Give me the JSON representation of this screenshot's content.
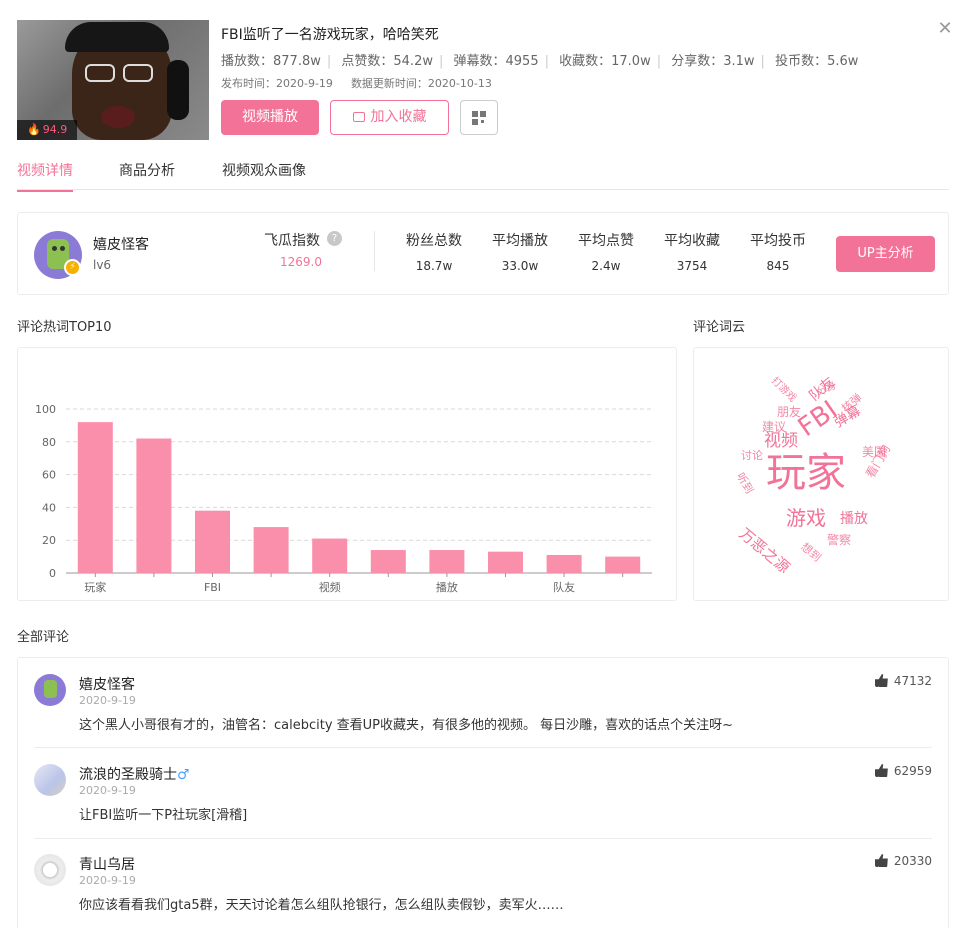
{
  "video": {
    "title": "FBI监听了一名游戏玩家，哈哈笑死",
    "heat": "94.9",
    "stats": [
      {
        "label": "播放数",
        "value": "877.8w"
      },
      {
        "label": "点赞数",
        "value": "54.2w"
      },
      {
        "label": "弹幕数",
        "value": "4955"
      },
      {
        "label": "收藏数",
        "value": "17.0w"
      },
      {
        "label": "分享数",
        "value": "3.1w"
      },
      {
        "label": "投币数",
        "value": "5.6w"
      }
    ],
    "stats_text": {
      "s0": "播放数：877.8w",
      "s1": "点赞数：54.2w",
      "s2": "弹幕数：4955",
      "s3": "收藏数：17.0w",
      "s4": "分享数：3.1w",
      "s5": "投币数：5.6w"
    },
    "publish_time": "发布时间：2020-9-19",
    "update_time": "数据更新时间：2020-10-13",
    "play_button": "视频播放",
    "fav_button": "加入收藏"
  },
  "tabs": [
    "视频详情",
    "商品分析",
    "视频观众画像"
  ],
  "up": {
    "name": "嬉皮怪客",
    "level": "lv6",
    "feigua_label": "飞瓜指数",
    "feigua_value": "1269.0",
    "metrics": [
      {
        "label": "粉丝总数",
        "value": "18.7w"
      },
      {
        "label": "平均播放",
        "value": "33.0w"
      },
      {
        "label": "平均点赞",
        "value": "2.4w"
      },
      {
        "label": "平均收藏",
        "value": "3754"
      },
      {
        "label": "平均投币",
        "value": "845"
      }
    ],
    "analysis_button": "UP主分析"
  },
  "sections": {
    "hot_words": "评论热词TOP10",
    "word_cloud": "评论词云",
    "all_comments": "全部评论"
  },
  "chart_data": {
    "type": "bar",
    "title": "评论热词TOP10",
    "categories": [
      "玩家",
      "",
      "FBI",
      "",
      "视频",
      "",
      "播放",
      "",
      "队友",
      ""
    ],
    "values": [
      92,
      82,
      38,
      28,
      21,
      14,
      14,
      13,
      11,
      10
    ],
    "ylim": [
      0,
      100
    ],
    "yticks": [
      0,
      20,
      40,
      60,
      80,
      100
    ],
    "grid": true,
    "color": "#f98fab"
  },
  "word_cloud": [
    {
      "word": "玩家",
      "size": 40
    },
    {
      "word": "FBI",
      "size": 26
    },
    {
      "word": "游戏",
      "size": 20
    },
    {
      "word": "视频",
      "size": 17
    },
    {
      "word": "队友",
      "size": 14
    },
    {
      "word": "弹幕",
      "size": 14
    },
    {
      "word": "万恶之源",
      "size": 15
    },
    {
      "word": "播放",
      "size": 14
    },
    {
      "word": "美国",
      "size": 12
    },
    {
      "word": "看门狗",
      "size": 12
    },
    {
      "word": "建议",
      "size": 12
    },
    {
      "word": "朋友",
      "size": 12
    },
    {
      "word": "警察",
      "size": 12
    },
    {
      "word": "听到",
      "size": 11
    },
    {
      "word": "想到",
      "size": 11
    },
    {
      "word": "讨论",
      "size": 11
    },
    {
      "word": "打游戏",
      "size": 10
    },
    {
      "word": "分身",
      "size": 10
    },
    {
      "word": "核弹",
      "size": 11
    }
  ],
  "comments": [
    {
      "name": "嬉皮怪客",
      "male": "",
      "date": "2020-9-19",
      "likes": "47132",
      "text": "这个黑人小哥很有才的，油管名：calebcity 查看UP收藏夹，有很多他的视频。 每日沙雕，喜欢的话点个关注呀~"
    },
    {
      "name": "流浪的圣殿骑士",
      "male": "♂",
      "date": "2020-9-19",
      "likes": "62959",
      "text": "让FBI监听一下P社玩家[滑稽]"
    },
    {
      "name": "青山乌居",
      "male": "",
      "date": "2020-9-19",
      "likes": "20330",
      "text": "你应该看看我们gta5群，天天讨论着怎么组队抢银行，怎么组队卖假钞，卖军火……"
    }
  ],
  "colors": {
    "accent": "#f27397",
    "bar": "#f98fab"
  }
}
